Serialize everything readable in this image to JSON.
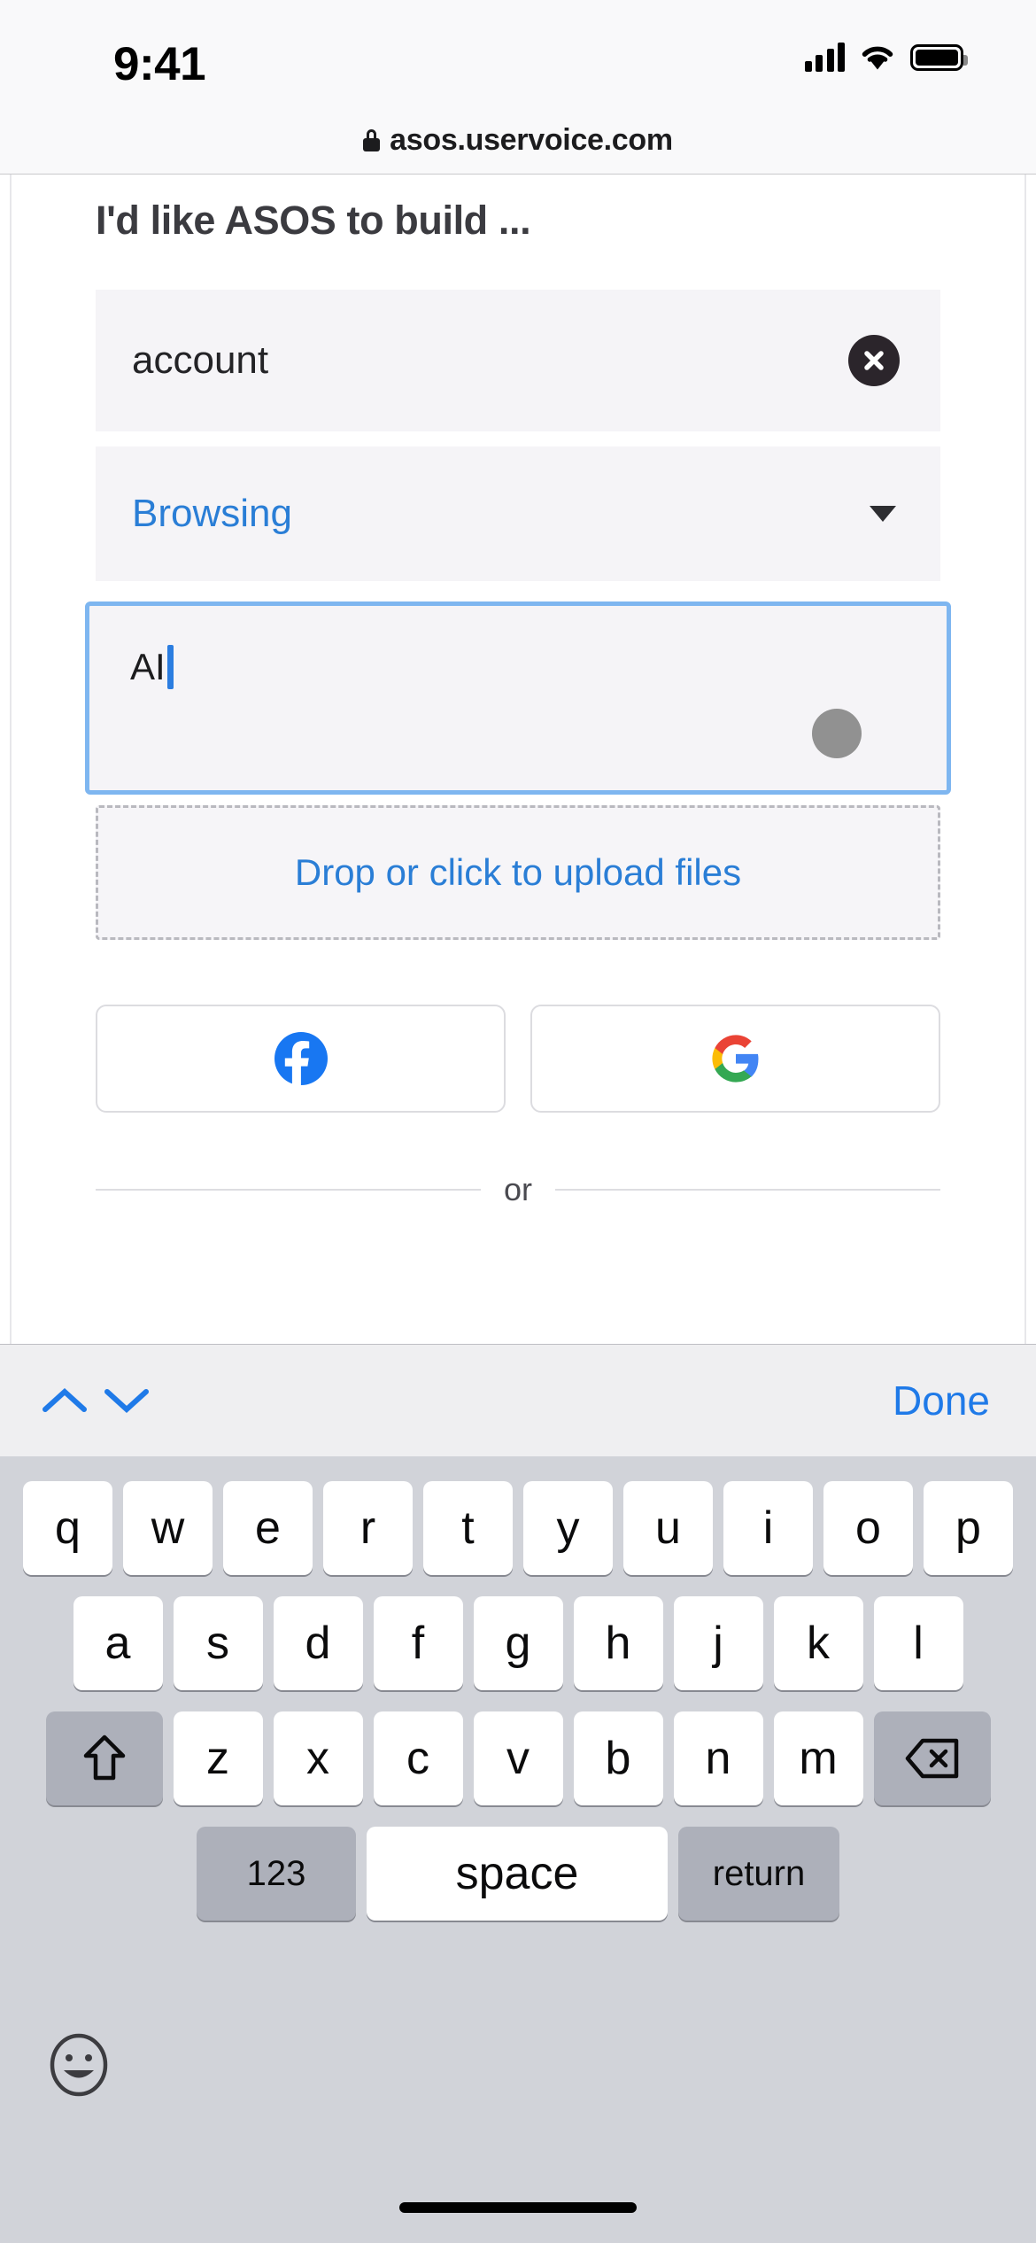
{
  "statusbar": {
    "time": "9:41",
    "signal_icon": "cellular-signal-icon",
    "wifi_icon": "wifi-icon",
    "battery_icon": "battery-full-icon"
  },
  "browser": {
    "lock_icon": "lock-icon",
    "url": "asos.uservoice.com"
  },
  "form": {
    "title": "I'd like ASOS to build ...",
    "search": {
      "value": "account",
      "clear_icon": "clear-circle-x-icon"
    },
    "category": {
      "selected": "Browsing",
      "caret_icon": "chevron-down-icon"
    },
    "description": {
      "value": "AI",
      "focused": true
    },
    "upload": {
      "label": "Drop or click to upload files"
    },
    "social": [
      {
        "name": "facebook",
        "icon": "facebook-icon"
      },
      {
        "name": "google",
        "icon": "google-icon"
      }
    ],
    "divider_text": "or"
  },
  "keyboard_accessory": {
    "prev_icon": "chevron-up-icon",
    "next_icon": "chevron-down-icon",
    "done_label": "Done"
  },
  "keyboard": {
    "row1": [
      "q",
      "w",
      "e",
      "r",
      "t",
      "y",
      "u",
      "i",
      "o",
      "p"
    ],
    "row2": [
      "a",
      "s",
      "d",
      "f",
      "g",
      "h",
      "j",
      "k",
      "l"
    ],
    "row3": [
      "z",
      "x",
      "c",
      "v",
      "b",
      "n",
      "m"
    ],
    "shift_icon": "shift-arrow-icon",
    "delete_icon": "backspace-delete-icon",
    "numbers_label": "123",
    "space_label": "space",
    "return_label": "return",
    "emoji_icon": "emoji-smiley-icon"
  },
  "colors": {
    "accent_blue": "#2a7ed6",
    "ios_blue": "#1f7ae8",
    "focus_border": "#7eb6f0",
    "field_bg": "#f5f4f7",
    "keyboard_bg": "#d1d3d9",
    "key_gray": "#adb0ba",
    "touch_dot": "#919191"
  }
}
